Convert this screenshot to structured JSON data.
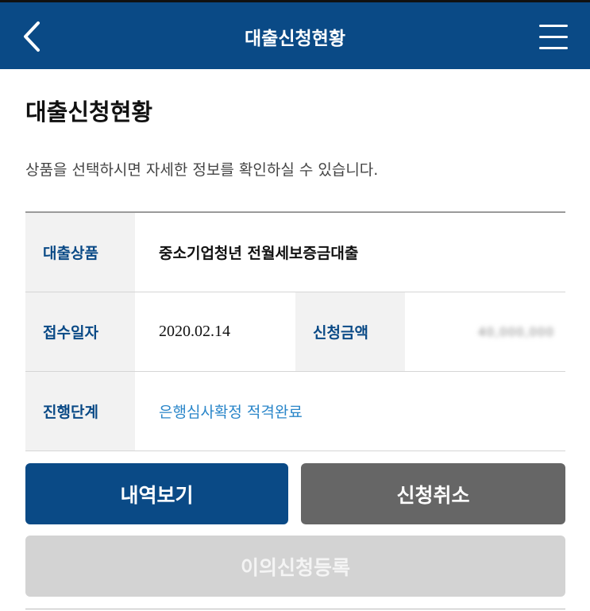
{
  "header": {
    "title": "대출신청현황",
    "back_icon": "chevron-left-icon",
    "menu_icon": "hamburger-menu-icon",
    "background": "#0a4a86"
  },
  "page": {
    "title": "대출신청현황",
    "description": "상품을 선택하시면 자세한 정보를 확인하실 수 있습니다."
  },
  "details": {
    "product_label": "대출상품",
    "product_value": "중소기업청년 전월세보증금대출",
    "date_label": "접수일자",
    "date_value": "2020.02.14",
    "amount_label": "신청금액",
    "amount_value": "40,000,000",
    "status_label": "진행단계",
    "status_value": "은행심사확정 적격완료"
  },
  "buttons": {
    "history": "내역보기",
    "cancel": "신청취소",
    "objection": "이의신청등록"
  }
}
